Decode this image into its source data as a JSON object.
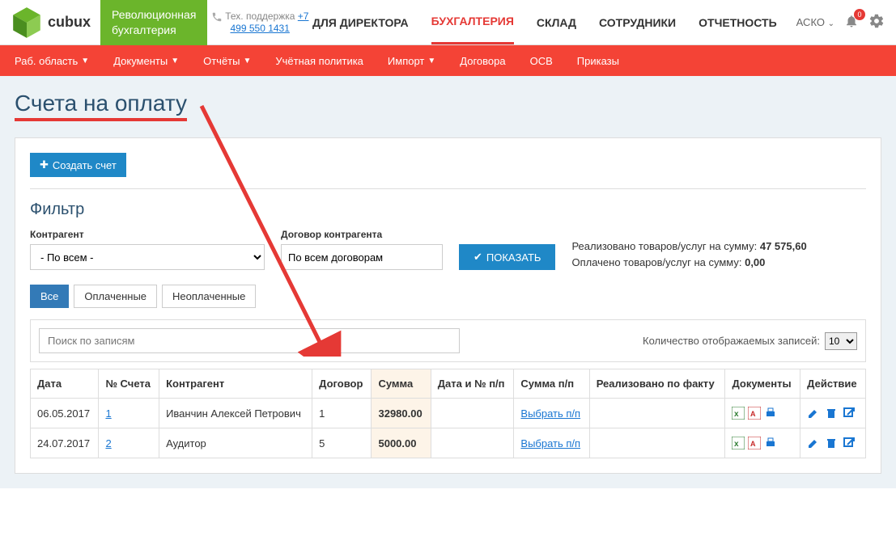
{
  "support": {
    "label": "Тех. поддержка",
    "phone": "+7 499 550 1431"
  },
  "logo": {
    "text": "cubux",
    "tagline1": "Революционная",
    "tagline2": "бухгалтерия"
  },
  "mainnav": [
    "ДЛЯ ДИРЕКТОРА",
    "БУХГАЛТЕРИЯ",
    "СКЛАД",
    "СОТРУДНИКИ",
    "ОТЧЕТНОСТЬ"
  ],
  "user": {
    "name": "АСКО",
    "badge": "0"
  },
  "subnav": [
    "Раб. область",
    "Документы",
    "Отчёты",
    "Учётная политика",
    "Импорт",
    "Договора",
    "ОСВ",
    "Приказы"
  ],
  "subnav_caret": [
    true,
    true,
    true,
    false,
    true,
    false,
    false,
    false
  ],
  "page_title": "Счета на оплату",
  "create_btn": "Создать счет",
  "filter": {
    "title": "Фильтр",
    "contragent_label": "Контрагент",
    "contragent_value": "- По всем -",
    "contract_label": "Договор контрагента",
    "contract_value": "По всем договорам",
    "show_btn": "ПОКАЗАТЬ",
    "summary1_label": "Реализовано товаров/услуг на сумму:",
    "summary1_value": "47 575,60",
    "summary2_label": "Оплачено товаров/услуг на сумму:",
    "summary2_value": "0,00"
  },
  "tabs": [
    "Все",
    "Оплаченные",
    "Неоплаченные"
  ],
  "search_placeholder": "Поиск по записям",
  "pager_label": "Количество отображаемых записей:",
  "page_size": "10",
  "columns": [
    "Дата",
    "№ Счета",
    "Контрагент",
    "Договор",
    "Сумма",
    "Дата и № п/п",
    "Сумма п/п",
    "Реализовано по факту",
    "Документы",
    "Действие"
  ],
  "rows": [
    {
      "date": "06.05.2017",
      "num": "1",
      "contragent": "Иванчин Алексей Петрович",
      "contract": "1",
      "sum": "32980.00",
      "pp_date": "",
      "pp_sum_link": "Выбрать п/п",
      "fact": ""
    },
    {
      "date": "24.07.2017",
      "num": "2",
      "contragent": "Аудитор",
      "contract": "5",
      "sum": "5000.00",
      "pp_date": "",
      "pp_sum_link": "Выбрать п/п",
      "fact": ""
    }
  ]
}
